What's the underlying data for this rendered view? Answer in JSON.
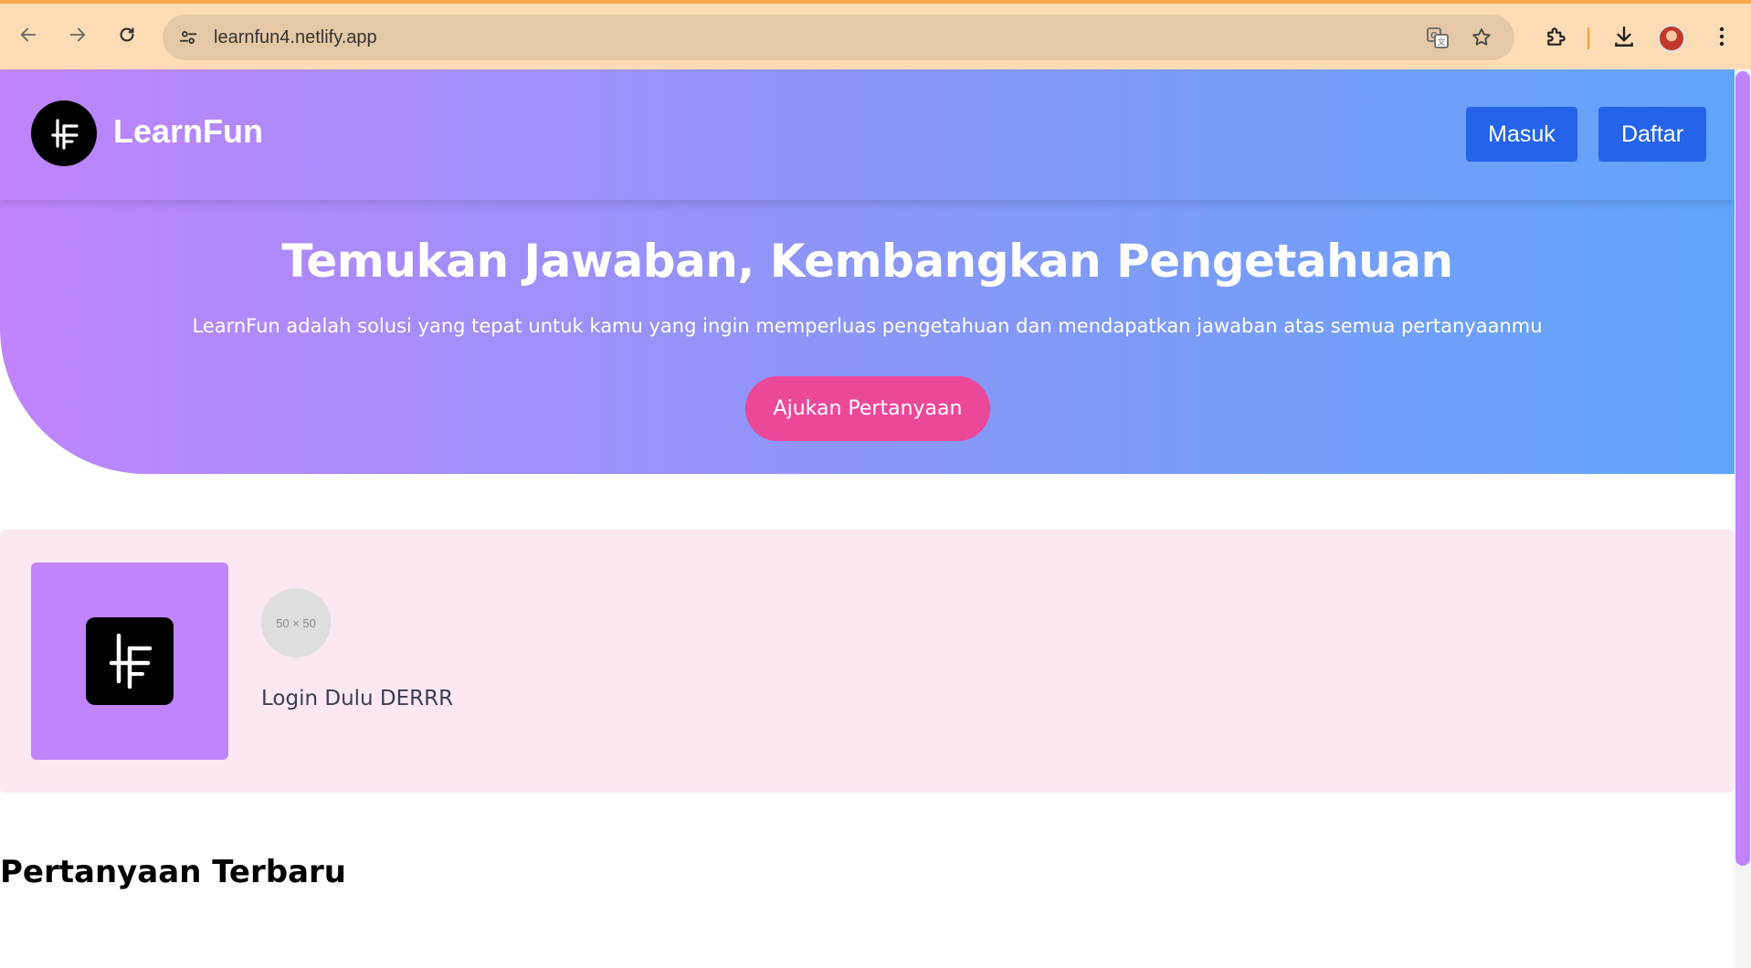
{
  "browser": {
    "url": "learnfun4.netlify.app",
    "icons": [
      "back-arrow-icon",
      "forward-arrow-icon",
      "reload-icon",
      "site-settings-icon",
      "translate-icon",
      "bookmark-star-icon",
      "extensions-icon",
      "download-icon",
      "profile-avatar",
      "more-menu-icon"
    ]
  },
  "header": {
    "brand": "LearnFun",
    "login_label": "Masuk",
    "register_label": "Daftar"
  },
  "hero": {
    "title": "Temukan Jawaban, Kembangkan Pengetahuan",
    "subtitle": "LearnFun adalah solusi yang tepat untuk kamu yang ingin memperluas pengetahuan dan mendapatkan jawaban atas semua pertanyaanmu",
    "cta_label": "Ajukan Pertanyaan"
  },
  "user_card": {
    "avatar_placeholder": "50 × 50",
    "message": "Login Dulu DERRR"
  },
  "latest": {
    "title": "Pertanyaan Terbaru"
  },
  "colors": {
    "gradient_start": "#c084fc",
    "gradient_end": "#60a5fa",
    "button_blue": "#2563eb",
    "cta_pink": "#ec4899",
    "card_bg": "#fce7f3",
    "browser_bar": "#fddcb5"
  }
}
